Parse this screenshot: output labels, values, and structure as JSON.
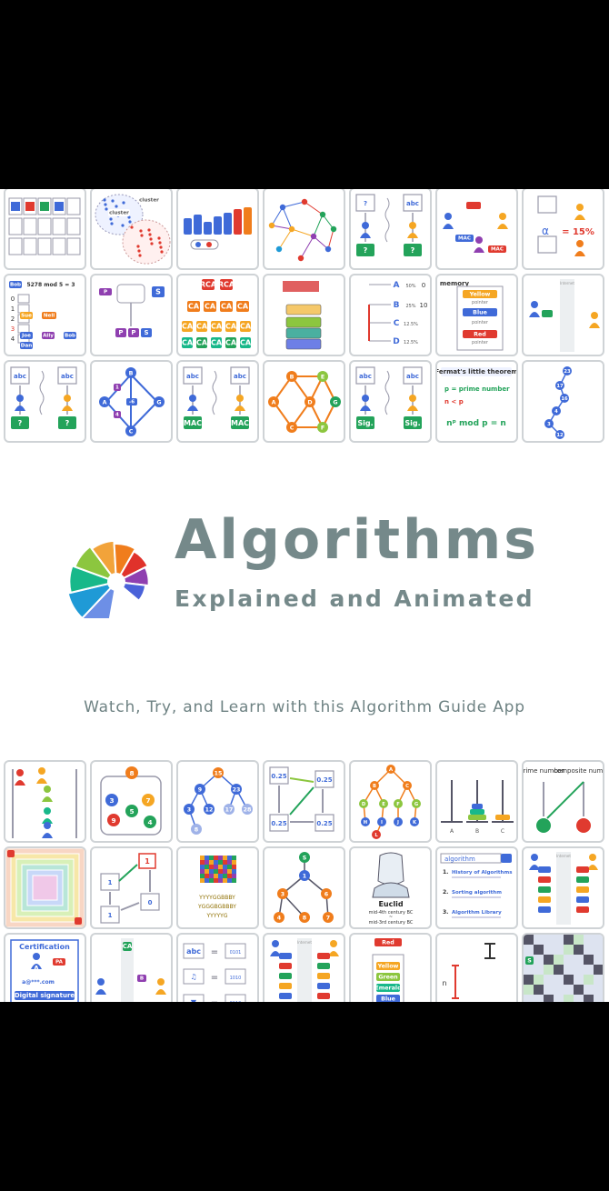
{
  "app": {
    "title": "Algorithms",
    "subtitle": "Explained and Animated",
    "tagline": "Watch, Try, and Learn with this Algorithm Guide App"
  },
  "colors": {
    "title": "#75898a",
    "tile_border": "#cfd3d6",
    "letterbox": "#000000",
    "logo_slices": [
      "#4a62d9",
      "#6d8fe6",
      "#1f9ad6",
      "#18b88a",
      "#8cc63f",
      "#f2a33a",
      "#f07d1c",
      "#e0322b",
      "#8f3fb0"
    ]
  },
  "tiles_top": [
    {
      "kind": "table-blocks"
    },
    {
      "kind": "clusters",
      "labels": [
        "cluster",
        "cluster",
        "cluster"
      ]
    },
    {
      "kind": "bar-sort",
      "labels": [
        "3",
        "4",
        "1",
        "2",
        "5",
        "6"
      ]
    },
    {
      "kind": "network-graph"
    },
    {
      "kind": "message-auth",
      "labels": [
        "?"
      ]
    },
    {
      "kind": "mac-exchange",
      "labels": [
        "MAC",
        "MAC"
      ]
    },
    {
      "kind": "probability",
      "labels": [
        "α",
        "= 15%"
      ]
    },
    {
      "kind": "hash-table",
      "labels": [
        "5278 mod 5 = 3",
        "0",
        "1",
        "2",
        "3",
        "4",
        "Sue",
        "Nell",
        "Joe",
        "Ally",
        "Bob",
        "Dan"
      ]
    },
    {
      "kind": "public-key",
      "labels": [
        "P",
        "S",
        "P",
        "P",
        "S"
      ]
    },
    {
      "kind": "certificate-tree",
      "labels": [
        "RCA",
        "RCA",
        "CA",
        "CA",
        "CA",
        "CA"
      ]
    },
    {
      "kind": "block-stack"
    },
    {
      "kind": "huffman",
      "labels": [
        "A",
        "B",
        "C",
        "D",
        "50%",
        "25%",
        "12.5%",
        "12.5%",
        "0",
        "10"
      ]
    },
    {
      "kind": "memory",
      "labels": [
        "memory",
        "Yellow",
        "Blue",
        "Red",
        "pointer"
      ]
    },
    {
      "kind": "internet-keys",
      "labels": [
        "Internet"
      ]
    },
    {
      "kind": "hash-verify",
      "labels": [
        "abc",
        "abc",
        "?",
        "?"
      ]
    },
    {
      "kind": "bellman-ford",
      "labels": [
        "A",
        "B",
        "C",
        "G",
        "1",
        "4",
        "-6"
      ]
    },
    {
      "kind": "mac-verify",
      "labels": [
        "abc",
        "abc",
        "MAC",
        "MAC",
        "Internet"
      ]
    },
    {
      "kind": "dijkstra",
      "labels": [
        "A",
        "B",
        "C",
        "D",
        "E",
        "F",
        "G",
        "3",
        "4",
        "6",
        "9",
        "2",
        "5",
        "7"
      ]
    },
    {
      "kind": "signature",
      "labels": [
        "abc",
        "abc",
        "Sig.",
        "Sig.",
        "Internet"
      ]
    },
    {
      "kind": "fermat",
      "labels": [
        "Fermat's little theorem",
        "p = prime number",
        "n < p",
        "nᵖ mod p = n"
      ]
    },
    {
      "kind": "binary-tree",
      "labels": [
        "23",
        "17",
        "16",
        "4",
        "3",
        "12"
      ]
    }
  ],
  "tiles_bottom": [
    {
      "kind": "people-queue"
    },
    {
      "kind": "heap-bag",
      "labels": [
        "8",
        "3",
        "7",
        "9",
        "5",
        "4"
      ]
    },
    {
      "kind": "bst",
      "labels": [
        "15",
        "9",
        "23",
        "3",
        "12",
        "17",
        "28",
        "8"
      ]
    },
    {
      "kind": "pagerank",
      "labels": [
        "A",
        "0.25",
        "0.25",
        "0.25",
        "0.25"
      ]
    },
    {
      "kind": "tree-search",
      "labels": [
        "A",
        "B",
        "C",
        "D",
        "E",
        "F",
        "G",
        "H",
        "I",
        "J",
        "K",
        "L"
      ]
    },
    {
      "kind": "hanoi",
      "labels": [
        "A",
        "B",
        "C"
      ]
    },
    {
      "kind": "primality",
      "labels": [
        "prime number",
        "composite number"
      ]
    },
    {
      "kind": "voronoi"
    },
    {
      "kind": "mod-cycle",
      "labels": [
        "1",
        "1",
        "0",
        "1"
      ]
    },
    {
      "kind": "matrix",
      "labels": [
        "YYYYGGBBBY",
        "YGGGBGBBBY",
        "YYYYYG"
      ]
    },
    {
      "kind": "dfs-tree",
      "labels": [
        "S",
        "1",
        "3",
        "6",
        "4",
        "8",
        "7"
      ]
    },
    {
      "kind": "euclid",
      "labels": [
        "Euclid",
        "mid-4th century BC",
        "~",
        "mid-3rd century BC"
      ]
    },
    {
      "kind": "library-menu",
      "labels": [
        "algorithm",
        "1.",
        "History of Algorithms",
        "2.",
        "Sorting algorithm",
        "3.",
        "Algorithm Library"
      ]
    },
    {
      "kind": "key-exchange",
      "labels": [
        "Internet"
      ]
    },
    {
      "kind": "certification",
      "labels": [
        "Certification",
        "A",
        "PA",
        "a@***.com",
        "Digital signature"
      ]
    },
    {
      "kind": "ca-user",
      "labels": [
        "CA",
        "B"
      ]
    },
    {
      "kind": "encoding",
      "labels": [
        "abc",
        "=",
        "0101",
        "1010",
        "0110"
      ]
    },
    {
      "kind": "crossing",
      "labels": [
        "Internet"
      ]
    },
    {
      "kind": "stack",
      "labels": [
        "Red",
        "Yellow",
        "Green",
        "Emerald",
        "Blue"
      ]
    },
    {
      "kind": "gcd",
      "labels": [
        "n",
        "417",
        "278"
      ]
    },
    {
      "kind": "maze",
      "labels": [
        "S"
      ]
    }
  ]
}
